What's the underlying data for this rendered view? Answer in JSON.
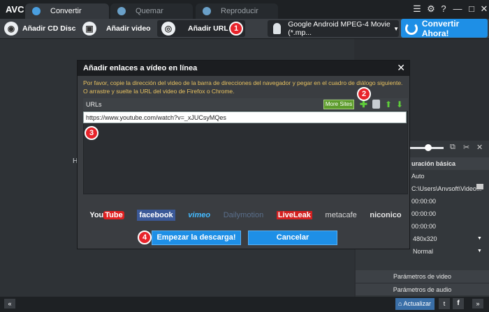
{
  "app": {
    "logo": "AVC"
  },
  "tabs": [
    {
      "label": "Convertir"
    },
    {
      "label": "Quemar"
    },
    {
      "label": "Reproducir"
    }
  ],
  "toolbar": {
    "add_cd": "Añadir CD Disc",
    "add_video": "Añadir video",
    "add_url": "Añadir URL",
    "profile": "Google Android MPEG-4 Movie (*.mp...",
    "convert": "Convertir Ahora!"
  },
  "callouts": [
    "1",
    "2",
    "3",
    "4"
  ],
  "background_text": {
    "left_char": "H"
  },
  "right_panel": {
    "section": "uración básica",
    "rows": [
      "Auto",
      "C:\\Users\\Anvsoft\\Video...",
      "00:00:00",
      "00:00:00",
      "00:00:00",
      "480x320",
      "Normal"
    ],
    "video_params": "Parámetros de video",
    "audio_params": "Parámetros de audio"
  },
  "dialog": {
    "title": "Añadir enlaces a vídeo en línea",
    "description": "Por favor, copie la dirección del video de la barra de direcciones del navegador y pegar en el cuadro de diálogo siguiente. O arrastre y suelte la URL del video de Firefox o Chrome.",
    "urls_label": "URLs",
    "more_sites": "More Sites",
    "url_value": "https://www.youtube.com/watch?v=_xJUCsyMQes",
    "sites": [
      "YouTube",
      "facebook",
      "vimeo",
      "Dailymotion",
      "LiveLeak",
      "metacafe",
      "niconico"
    ],
    "start_button": "Empezar la descarga!",
    "cancel_button": "Cancelar"
  },
  "bottom": {
    "update": "Actualizar"
  },
  "colors": {
    "accent": "#1e8fe6",
    "callout": "#e8232a",
    "desc": "#e8c260"
  }
}
